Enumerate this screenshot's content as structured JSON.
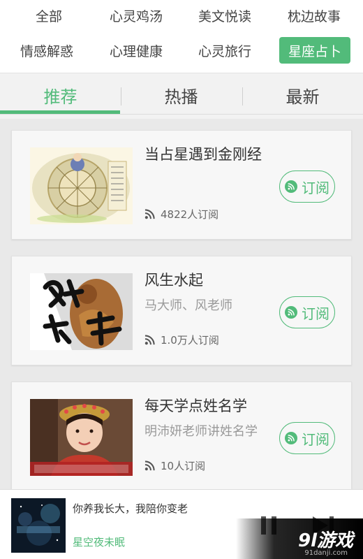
{
  "categories": [
    {
      "label": "全部",
      "active": false
    },
    {
      "label": "心灵鸡汤",
      "active": false
    },
    {
      "label": "美文悦读",
      "active": false
    },
    {
      "label": "枕边故事",
      "active": false
    },
    {
      "label": "情感解惑",
      "active": false
    },
    {
      "label": "心理健康",
      "active": false
    },
    {
      "label": "心灵旅行",
      "active": false
    },
    {
      "label": "星座占卜",
      "active": true
    }
  ],
  "tabs": [
    {
      "label": "推荐",
      "active": true
    },
    {
      "label": "热播",
      "active": false
    },
    {
      "label": "最新",
      "active": false
    }
  ],
  "cards": [
    {
      "title": "当占星遇到金刚经",
      "subtitle": "",
      "count": "4822人订阅",
      "button": "订阅",
      "thumb": "zodiac-wheel-image"
    },
    {
      "title": "风生水起",
      "subtitle": "马大师、风老师",
      "count": "1.0万人订阅",
      "button": "订阅",
      "thumb": "calligraphy-image"
    },
    {
      "title": "每天学点姓名学",
      "subtitle": "明沛妍老师讲姓名学",
      "count": "10人订阅",
      "button": "订阅",
      "thumb": "portrait-image"
    }
  ],
  "player": {
    "title": "你养我长大，我陪你变老",
    "artist": "星空夜未眠"
  },
  "watermark": {
    "brand": "9l游戏",
    "site": "91danji.com"
  },
  "colors": {
    "accent": "#52bb7a",
    "background": "#e9e9e9"
  }
}
